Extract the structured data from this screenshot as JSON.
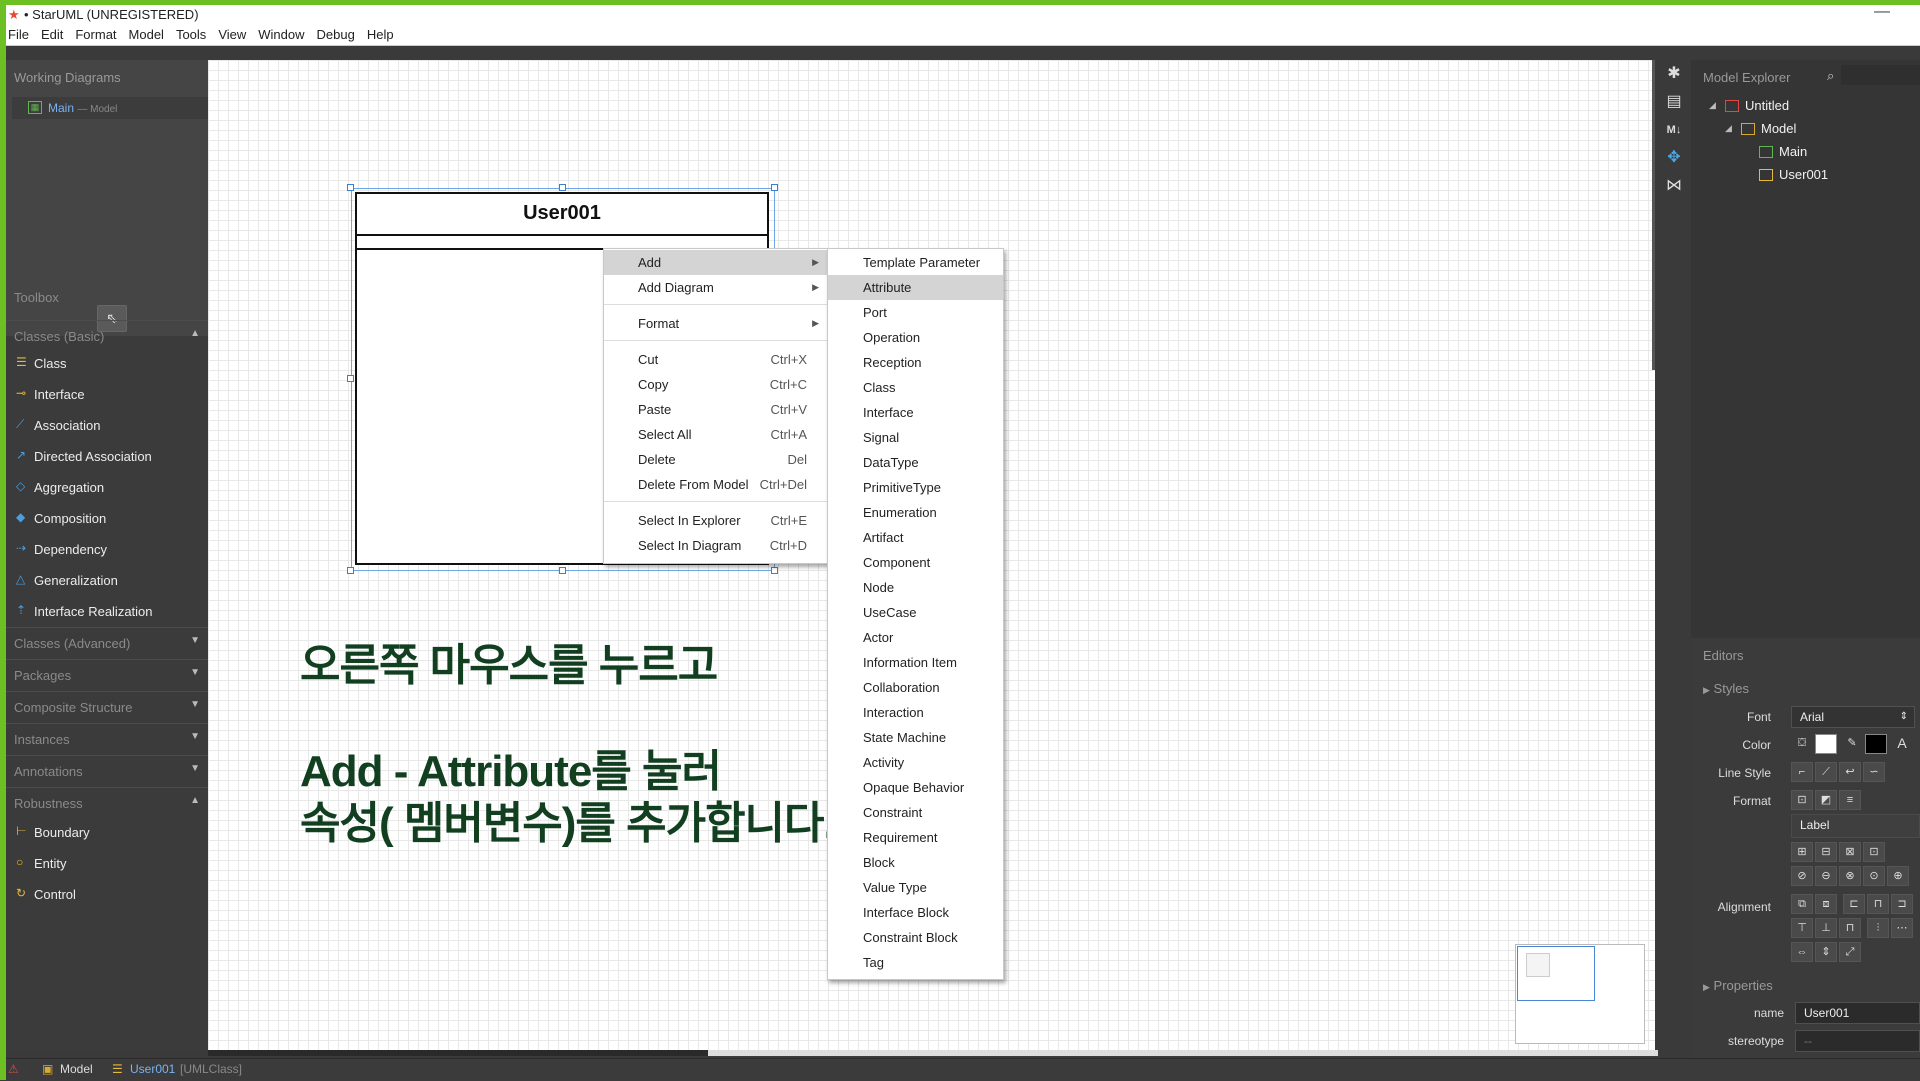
{
  "window": {
    "title": "• StarUML (UNREGISTERED)",
    "minimize_glyph": "—"
  },
  "menubar": [
    "File",
    "Edit",
    "Format",
    "Model",
    "Tools",
    "View",
    "Window",
    "Debug",
    "Help"
  ],
  "working_diagrams": {
    "header": "Working Diagrams",
    "item": {
      "label": "Main",
      "sub": "— Model"
    }
  },
  "toolbox": {
    "header": "Toolbox",
    "pointer_icon": "pointer-icon",
    "sections": {
      "classes_basic": "Classes (Basic)",
      "classes_advanced": "Classes (Advanced)",
      "packages": "Packages",
      "composite_structure": "Composite Structure",
      "instances": "Instances",
      "annotations": "Annotations",
      "robustness": "Robustness"
    },
    "basic_tools": [
      "Class",
      "Interface",
      "Association",
      "Directed Association",
      "Aggregation",
      "Composition",
      "Dependency",
      "Generalization",
      "Interface Realization"
    ],
    "robustness_tools": [
      "Boundary",
      "Entity",
      "Control"
    ]
  },
  "diagram": {
    "class_name": "User001",
    "caption_line1": "오른쪽 마우스를 누르고",
    "caption_line2": "Add - Attribute를 눌러",
    "caption_line3": "속성( 멤버변수)를 추가합니다."
  },
  "context_menu": {
    "items": [
      {
        "label": "Add",
        "submenu": true,
        "highlighted": true
      },
      {
        "label": "Add Diagram",
        "submenu": true
      },
      {
        "label": "Format",
        "submenu": true
      },
      {
        "label": "Cut",
        "shortcut": "Ctrl+X"
      },
      {
        "label": "Copy",
        "shortcut": "Ctrl+C"
      },
      {
        "label": "Paste",
        "shortcut": "Ctrl+V"
      },
      {
        "label": "Select All",
        "shortcut": "Ctrl+A"
      },
      {
        "label": "Delete",
        "shortcut": "Del"
      },
      {
        "label": "Delete From Model",
        "shortcut": "Ctrl+Del"
      },
      {
        "label": "Select In Explorer",
        "shortcut": "Ctrl+E"
      },
      {
        "label": "Select In Diagram",
        "shortcut": "Ctrl+D"
      }
    ]
  },
  "add_submenu": {
    "highlighted": "Attribute",
    "items": [
      "Template Parameter",
      "Attribute",
      "Port",
      "Operation",
      "Reception",
      "Class",
      "Interface",
      "Signal",
      "DataType",
      "PrimitiveType",
      "Enumeration",
      "Artifact",
      "Component",
      "Node",
      "UseCase",
      "Actor",
      "Information Item",
      "Collaboration",
      "Interaction",
      "State Machine",
      "Activity",
      "Opaque Behavior",
      "Constraint",
      "Requirement",
      "Block",
      "Value Type",
      "Interface Block",
      "Constraint Block",
      "Tag"
    ]
  },
  "model_explorer": {
    "header": "Model Explorer",
    "tree": {
      "root": "Untitled",
      "model": "Model",
      "diagram": "Main",
      "class": "User001"
    }
  },
  "editors": {
    "header": "Editors",
    "styles": "Styles",
    "font_label": "Font",
    "font_value": "Arial",
    "color_label": "Color",
    "line_style_label": "Line Style",
    "format_label": "Format",
    "label_field": "Label",
    "alignment_label": "Alignment",
    "properties": "Properties",
    "name_label": "name",
    "name_value": "User001",
    "stereotype_label": "stereotype",
    "stereotype_value": "--"
  },
  "statusbar": {
    "model": "Model",
    "element": "User001",
    "element_type": "[UMLClass]"
  },
  "colors": {
    "accent": "#6cc024",
    "caption": "#123f20",
    "selection": "#3a7fd0"
  }
}
